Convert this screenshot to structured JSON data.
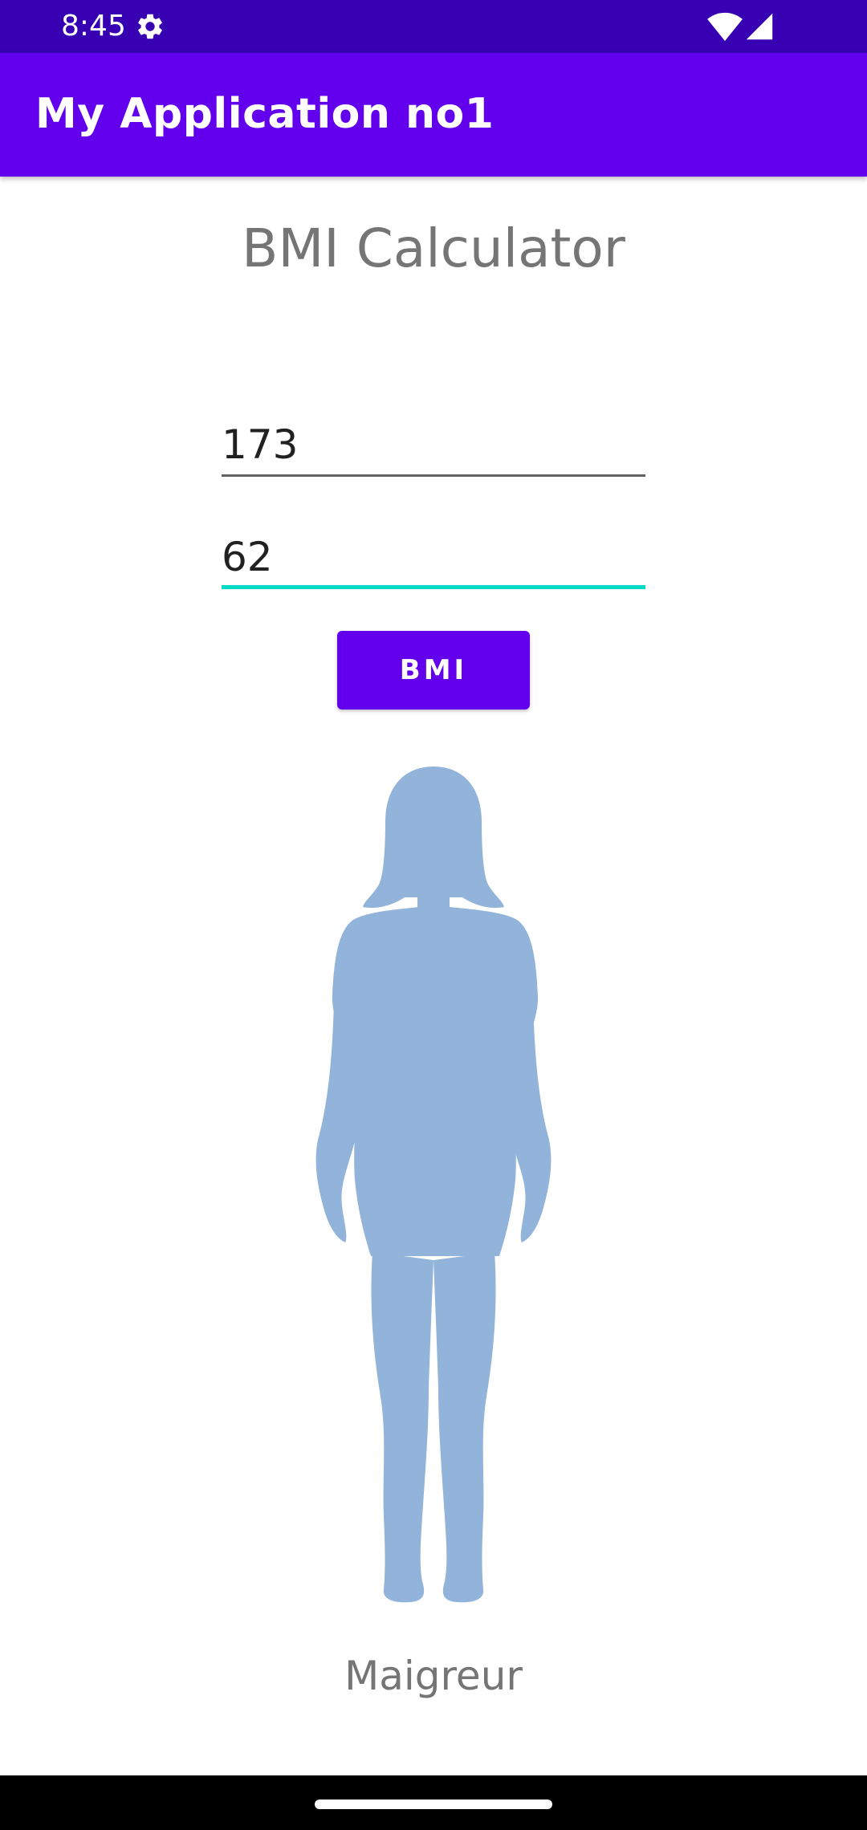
{
  "status_bar": {
    "time": "8:45",
    "icons": [
      "gear-icon",
      "wifi-icon",
      "cellular-signal-icon"
    ]
  },
  "app_bar": {
    "title": "My Application no1"
  },
  "main": {
    "heading": "BMI Calculator",
    "height_input": {
      "value": "173"
    },
    "weight_input": {
      "value": "62"
    },
    "bmi_button_label": "BMI",
    "figure_icon": "female-silhouette-icon",
    "result_label": "Maigreur"
  },
  "colors": {
    "status_bar": "#3700B3",
    "primary": "#6200EE",
    "accent": "#03DAC5",
    "silhouette": "#92B3DA",
    "secondary_text": "#757575"
  }
}
